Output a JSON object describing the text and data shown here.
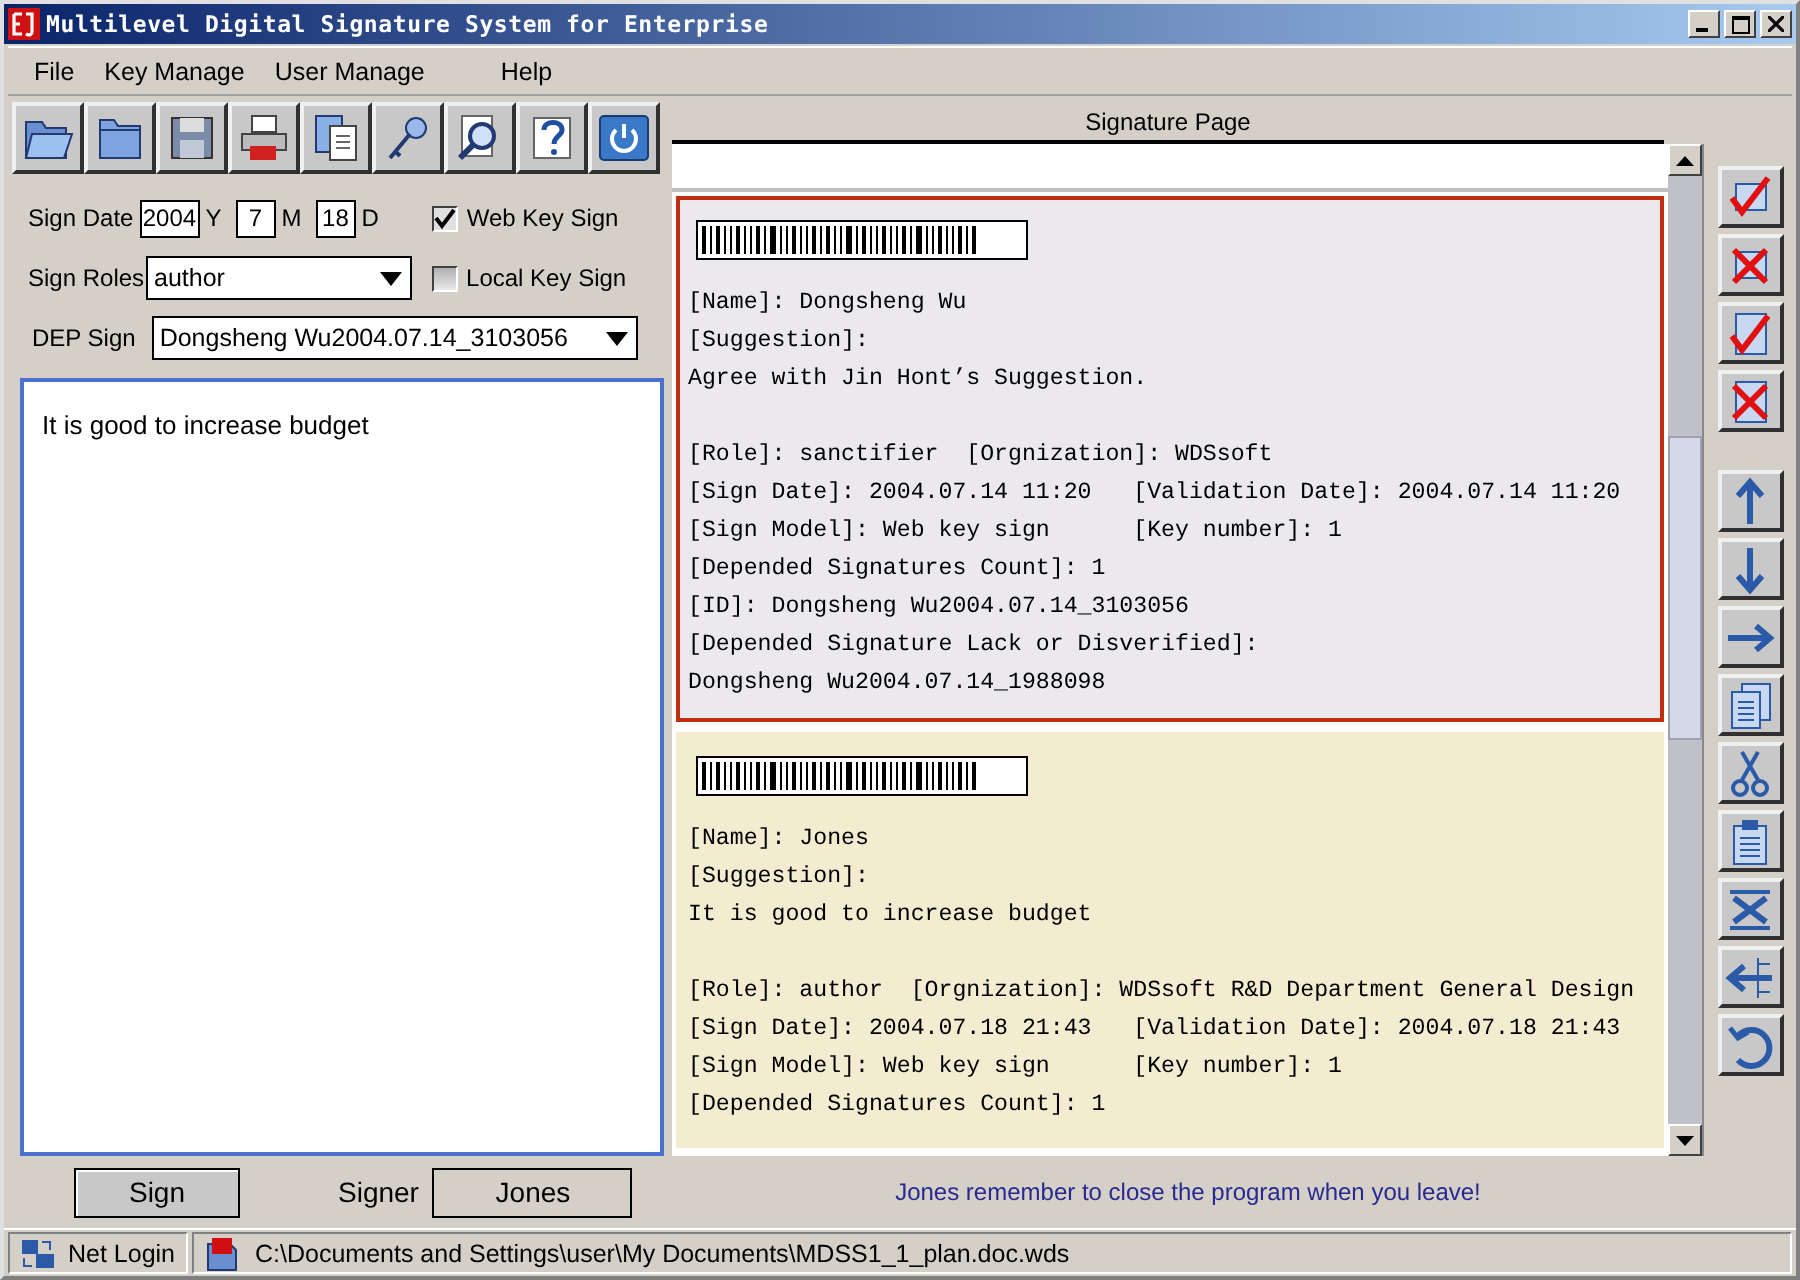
{
  "window": {
    "title": "Multilevel Digital Signature System for Enterprise"
  },
  "menu": [
    "File",
    "Key Manage",
    "User Manage",
    "Help"
  ],
  "form": {
    "sign_date": {
      "label": "Sign Date",
      "year": "2004",
      "year_unit": "Y",
      "month": "7",
      "month_unit": "M",
      "day": "18",
      "day_unit": "D"
    },
    "sign_roles": {
      "label": "Sign Roles",
      "value": "author"
    },
    "dep_sign": {
      "label": "DEP Sign",
      "value": "Dongsheng Wu2004.07.14_3103056"
    },
    "options": [
      {
        "label": "Web Key Sign",
        "checked": true
      },
      {
        "label": "Local Key Sign",
        "checked": false
      }
    ]
  },
  "suggestion_text": "It is good to increase budget",
  "sign_button": "Sign",
  "signer": {
    "label": "Signer",
    "value": "Jones"
  },
  "signature_page": {
    "title": "Signature Page",
    "signatures": [
      {
        "selected": true,
        "header_lines": [
          "[Name]: Dongsheng Wu",
          "[Suggestion]:",
          "Agree with Jin Hont’s Suggestion."
        ],
        "detail_lines": [
          "[Role]: sanctifier  [Orgnization]: WDSsoft",
          "[Sign Date]: 2004.07.14 11:20   [Validation Date]: 2004.07.14 11:20",
          "[Sign Model]: Web key sign      [Key number]: 1",
          "[Depended Signatures Count]: 1",
          "[ID]: Dongsheng Wu2004.07.14_3103056",
          "[Depended Signature Lack or Disverified]:",
          "Dongsheng Wu2004.07.14_1988098"
        ]
      },
      {
        "selected": false,
        "header_lines": [
          "[Name]: Jones",
          "[Suggestion]:",
          "It is good to increase budget"
        ],
        "detail_lines": [
          "[Role]: author  [Orgnization]: WDSsoft R&D Department General Design",
          "[Sign Date]: 2004.07.18 21:43   [Validation Date]: 2004.07.18 21:43",
          "[Sign Model]: Web key sign      [Key number]: 1",
          "[Depended Signatures Count]: 1"
        ]
      }
    ]
  },
  "message": "Jones remember to close the program when you leave!",
  "status_bar": {
    "login": "Net Login",
    "path": "C:\\Documents and Settings\\user\\My Documents\\MDSS1_1_plan.doc.wds"
  }
}
